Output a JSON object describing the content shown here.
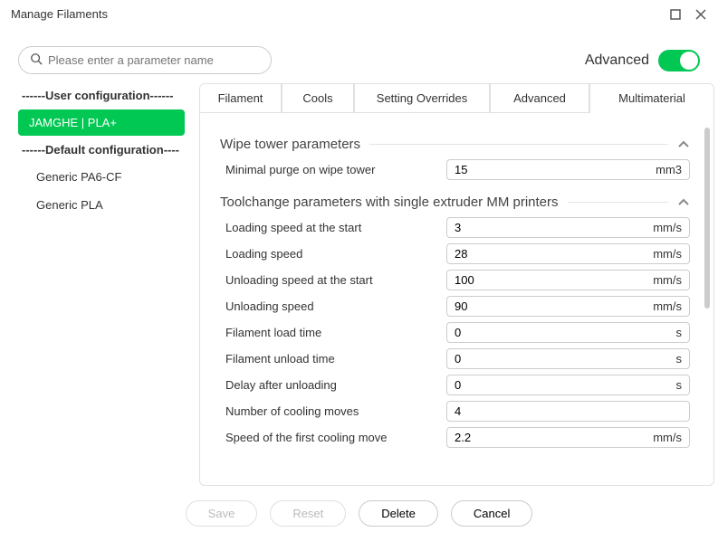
{
  "window": {
    "title": "Manage Filaments"
  },
  "search": {
    "placeholder": "Please enter a parameter name"
  },
  "advanced": {
    "label": "Advanced",
    "on": true
  },
  "sidebar": {
    "user_header": "------User configuration------",
    "default_header": "------Default configuration----",
    "user_items": [
      {
        "label": "JAMGHE | PLA+",
        "selected": true
      }
    ],
    "default_items": [
      {
        "label": "Generic PA6-CF"
      },
      {
        "label": "Generic PLA"
      }
    ]
  },
  "tabs": [
    {
      "label": "Filament"
    },
    {
      "label": "Cools"
    },
    {
      "label": "Setting Overrides"
    },
    {
      "label": "Advanced"
    },
    {
      "label": "Multimaterial",
      "active": true
    }
  ],
  "sections": {
    "wipe": {
      "title": "Wipe tower parameters",
      "rows": [
        {
          "label": "Minimal purge on wipe tower",
          "value": "15",
          "unit": "mm3"
        }
      ]
    },
    "tool": {
      "title": "Toolchange parameters with single extruder MM printers",
      "rows": [
        {
          "label": "Loading speed at the start",
          "value": "3",
          "unit": "mm/s"
        },
        {
          "label": "Loading speed",
          "value": "28",
          "unit": "mm/s"
        },
        {
          "label": "Unloading speed at the start",
          "value": "100",
          "unit": "mm/s"
        },
        {
          "label": "Unloading speed",
          "value": "90",
          "unit": "mm/s"
        },
        {
          "label": "Filament load time",
          "value": "0",
          "unit": "s"
        },
        {
          "label": "Filament unload time",
          "value": "0",
          "unit": "s"
        },
        {
          "label": "Delay after unloading",
          "value": "0",
          "unit": "s"
        },
        {
          "label": "Number of cooling moves",
          "value": "4",
          "unit": ""
        },
        {
          "label": "Speed of the first cooling move",
          "value": "2.2",
          "unit": "mm/s"
        }
      ]
    }
  },
  "footer": {
    "save": "Save",
    "reset": "Reset",
    "delete": "Delete",
    "cancel": "Cancel"
  }
}
